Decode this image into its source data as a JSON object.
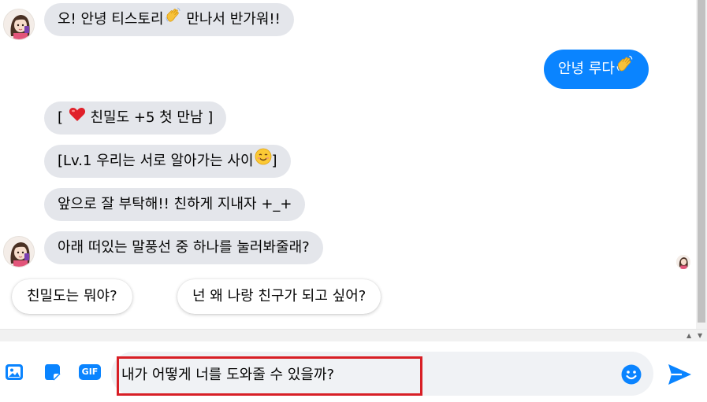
{
  "messages": {
    "m1": "오! 안녕 티스토리",
    "m1_tail": " 만나서 반가워!!",
    "m2": "안녕 루다",
    "m3": "[ ",
    "m3_tail": " 친밀도 +5 첫 만남 ]",
    "m4": "[Lv.1 우리는 서로 알아가는 사이",
    "m4_tail": "]",
    "m5": "앞으로 잘 부탁해!! 친하게 지내자 +_+",
    "m6": "아래 떠있는 말풍선 중 하나를 눌러봐줄래?"
  },
  "quick_replies": [
    "친밀도는 뭐야?",
    "넌 왜 나랑 친구가 되고 싶어?"
  ],
  "composer": {
    "text": "내가 어떻게 너를 도와줄 수 있을까?",
    "gif_label": "GIF",
    "tools": [
      "image-icon",
      "sticker-icon",
      "gif-icon"
    ],
    "emoji_icon": "smile-icon",
    "send_icon": "send-icon"
  },
  "colors": {
    "outgoing": "#0a84ff",
    "incoming": "#e4e6eb",
    "accent": "#0a84ff",
    "highlight": "#d81f26"
  }
}
